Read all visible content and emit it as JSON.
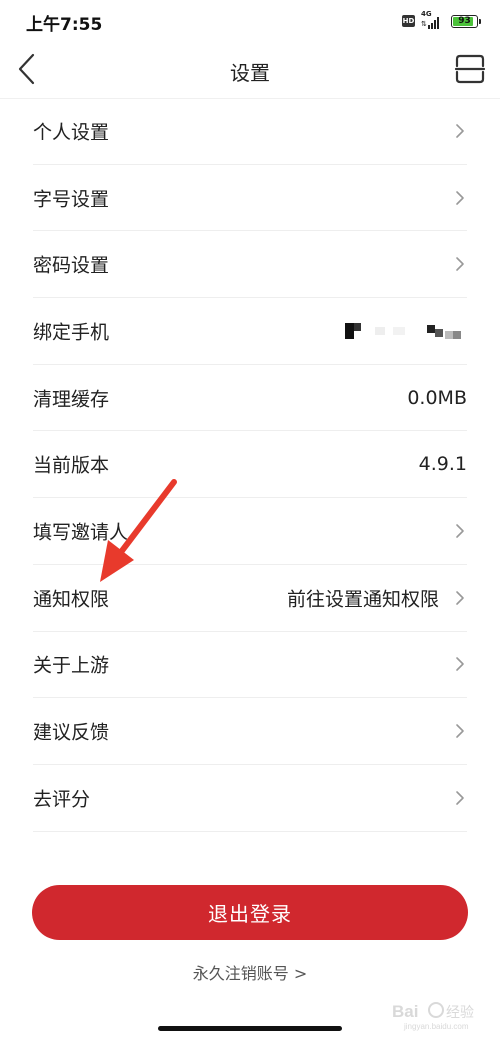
{
  "status_bar": {
    "time": "上午7:55",
    "hd_label": "HD",
    "network": "4G",
    "battery": "93",
    "battery_level": 0.93
  },
  "header": {
    "title": "设置"
  },
  "settings": [
    {
      "label": "个人设置",
      "value": "",
      "arrow": true
    },
    {
      "label": "字号设置",
      "value": "",
      "arrow": true
    },
    {
      "label": "密码设置",
      "value": "",
      "arrow": true
    },
    {
      "label": "绑定手机",
      "value": "",
      "arrow": false,
      "masked": true
    },
    {
      "label": "清理缓存",
      "value": "0.0MB",
      "arrow": false
    },
    {
      "label": "当前版本",
      "value": "4.9.1",
      "arrow": false
    },
    {
      "label": "填写邀请人",
      "value": "",
      "arrow": true
    },
    {
      "label": "通知权限",
      "value": "前往设置通知权限",
      "arrow": true
    },
    {
      "label": "关于上游",
      "value": "",
      "arrow": true
    },
    {
      "label": "建议反馈",
      "value": "",
      "arrow": true
    },
    {
      "label": "去评分",
      "value": "",
      "arrow": true
    }
  ],
  "footer": {
    "logout_label": "退出登录",
    "delete_account_label": "永久注销账号 >"
  },
  "colors": {
    "accent": "#d0282e",
    "annotation_arrow": "#e83a2c"
  }
}
